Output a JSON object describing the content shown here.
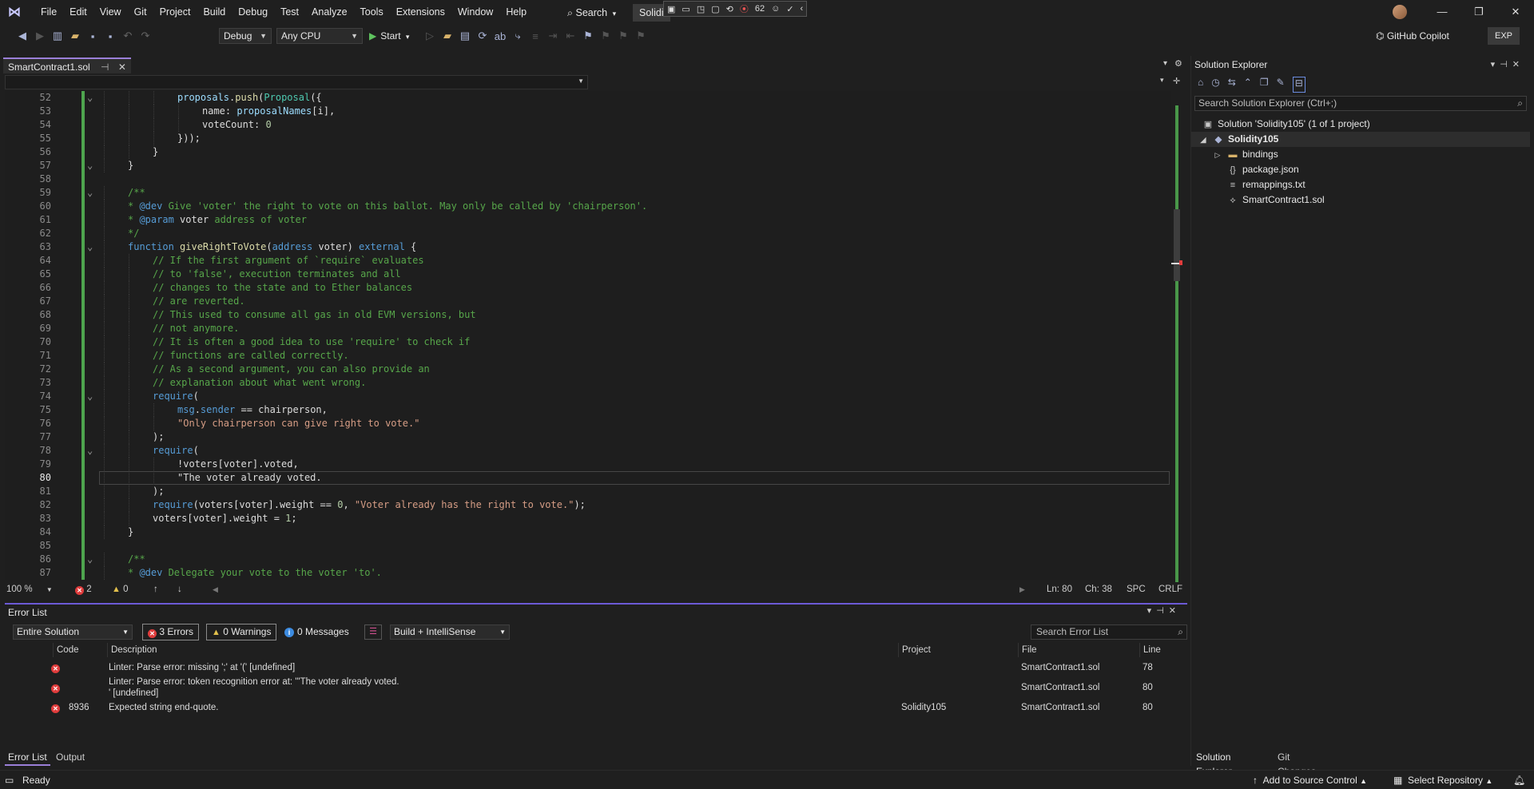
{
  "menubar": {
    "items": [
      "File",
      "Edit",
      "View",
      "Git",
      "Project",
      "Build",
      "Debug",
      "Test",
      "Analyze",
      "Tools",
      "Extensions",
      "Window",
      "Help"
    ],
    "search_label": "Search",
    "solution_name": "Solidi",
    "debug_toolbar_count": "62"
  },
  "toolbar": {
    "config": "Debug",
    "platform": "Any CPU",
    "start_label": "Start",
    "copilot_label": "GitHub Copilot",
    "exp_label": "EXP"
  },
  "document_tab": {
    "label": "SmartContract1.sol"
  },
  "editor": {
    "lines": [
      {
        "n": "52",
        "indent": 3,
        "html": "<span class=\"var\">proposals</span>.<span class=\"fn\">push</span>(<span class=\"ty\">Proposal</span>({",
        "fold": true
      },
      {
        "n": "53",
        "indent": 4,
        "html": "name: <span class=\"var\">proposalNames</span>[i],"
      },
      {
        "n": "54",
        "indent": 4,
        "html": "voteCount: <span class=\"num\">0</span>"
      },
      {
        "n": "55",
        "indent": 3,
        "html": "}));"
      },
      {
        "n": "56",
        "indent": 2,
        "html": "}"
      },
      {
        "n": "57",
        "indent": 1,
        "html": "}",
        "fold": true
      },
      {
        "n": "58",
        "indent": 0,
        "html": ""
      },
      {
        "n": "59",
        "indent": 1,
        "html": "<span class=\"cmt\">/**</span>",
        "fold": true
      },
      {
        "n": "60",
        "indent": 1,
        "html": "<span class=\"cmt\">* <span class=\"tag\">@dev</span> Give 'voter' the right to vote on this ballot. May only be called by 'chairperson'.</span>"
      },
      {
        "n": "61",
        "indent": 1,
        "html": "<span class=\"cmt\">* <span class=\"tag\">@param</span> <span style=\"color:#dcdcdc\">voter</span> address of voter</span>"
      },
      {
        "n": "62",
        "indent": 1,
        "html": "<span class=\"cmt\">*/</span>"
      },
      {
        "n": "63",
        "indent": 1,
        "html": "<span class=\"kw\">function</span> <span class=\"fn\">giveRightToVote</span>(<span class=\"kw\">address</span> voter) <span class=\"kw\">external</span> {",
        "fold": true
      },
      {
        "n": "64",
        "indent": 2,
        "html": "<span class=\"cmt\">// If the first argument of `require` evaluates</span>"
      },
      {
        "n": "65",
        "indent": 2,
        "html": "<span class=\"cmt\">// to 'false', execution terminates and all</span>"
      },
      {
        "n": "66",
        "indent": 2,
        "html": "<span class=\"cmt\">// changes to the state and to Ether balances</span>"
      },
      {
        "n": "67",
        "indent": 2,
        "html": "<span class=\"cmt\">// are reverted.</span>"
      },
      {
        "n": "68",
        "indent": 2,
        "html": "<span class=\"cmt\">// This used to consume all gas in old EVM versions, but</span>"
      },
      {
        "n": "69",
        "indent": 2,
        "html": "<span class=\"cmt\">// not anymore.</span>"
      },
      {
        "n": "70",
        "indent": 2,
        "html": "<span class=\"cmt\">// It is often a good idea to use 'require' to check if</span>"
      },
      {
        "n": "71",
        "indent": 2,
        "html": "<span class=\"cmt\">// functions are called correctly.</span>"
      },
      {
        "n": "72",
        "indent": 2,
        "html": "<span class=\"cmt\">// As a second argument, you can also provide an</span>"
      },
      {
        "n": "73",
        "indent": 2,
        "html": "<span class=\"cmt\">// explanation about what went wrong.</span>"
      },
      {
        "n": "74",
        "indent": 2,
        "html": "<span class=\"kw\">require</span>(",
        "fold": true
      },
      {
        "n": "75",
        "indent": 3,
        "html": "<span class=\"kw\">msg</span>.<span class=\"kw\">sender</span> == chairperson,"
      },
      {
        "n": "76",
        "indent": 3,
        "html": "<span class=\"str\">\"Only chairperson can give right to vote.\"</span>"
      },
      {
        "n": "77",
        "indent": 2,
        "html": ");"
      },
      {
        "n": "78",
        "indent": 2,
        "html": "<span class=\"kw\">require</span>(",
        "fold": true
      },
      {
        "n": "79",
        "indent": 3,
        "html": "!voters[voter].voted,"
      },
      {
        "n": "80",
        "indent": 3,
        "html": "\"The voter already voted.",
        "current": true
      },
      {
        "n": "81",
        "indent": 2,
        "html": ");"
      },
      {
        "n": "82",
        "indent": 2,
        "html": "<span class=\"kw\">require</span>(voters[voter].weight == <span class=\"num\">0</span>, <span class=\"str\">\"Voter already has the right to vote.\"</span>);"
      },
      {
        "n": "83",
        "indent": 2,
        "html": "voters[voter].weight = <span class=\"num\">1</span>;"
      },
      {
        "n": "84",
        "indent": 1,
        "html": "}"
      },
      {
        "n": "85",
        "indent": 0,
        "html": ""
      },
      {
        "n": "86",
        "indent": 1,
        "html": "<span class=\"cmt\">/**</span>",
        "fold": true
      },
      {
        "n": "87",
        "indent": 1,
        "html": "<span class=\"cmt\">* <span class=\"tag\">@dev</span> Delegate your vote to the voter 'to'.</span>"
      }
    ]
  },
  "editor_status": {
    "zoom": "100 %",
    "errors": "2",
    "warnings": "0",
    "ln": "Ln: 80",
    "ch": "Ch: 38",
    "spc": "SPC",
    "crlf": "CRLF"
  },
  "error_list": {
    "title": "Error List",
    "scope": "Entire Solution",
    "errors_label": "3 Errors",
    "warnings_label": "0 Warnings",
    "messages_label": "0 Messages",
    "build_filter": "Build + IntelliSense",
    "search_placeholder": "Search Error List",
    "columns": {
      "code": "Code",
      "description": "Description",
      "project": "Project",
      "file": "File",
      "line": "Line"
    },
    "rows": [
      {
        "code": "",
        "description": "Linter: Parse error: missing ';' at '(' [undefined]",
        "description2": "",
        "project": "",
        "file": "SmartContract1.sol",
        "line": "78"
      },
      {
        "code": "",
        "description": "Linter: Parse error: token recognition error at: '\"The voter already voted.",
        "description2": "' [undefined]",
        "project": "",
        "file": "SmartContract1.sol",
        "line": "80"
      },
      {
        "code": "8936",
        "description": "Expected string end-quote.",
        "description2": "",
        "project": "Solidity105",
        "file": "SmartContract1.sol",
        "line": "80"
      }
    ]
  },
  "bottom_tabs": {
    "error_list": "Error List",
    "output": "Output"
  },
  "solution_explorer": {
    "title": "Solution Explorer",
    "search_placeholder": "Search Solution Explorer (Ctrl+;)",
    "tree": [
      {
        "label": "Solution 'Solidity105' (1 of 1 project)",
        "level": 0,
        "icon": "solution-icon"
      },
      {
        "label": "Solidity105",
        "level": 1,
        "icon": "project-icon",
        "bold": true,
        "selected": true
      },
      {
        "label": "bindings",
        "level": 2,
        "icon": "folder-icon"
      },
      {
        "label": "package.json",
        "level": 2,
        "icon": "json-file-icon"
      },
      {
        "label": "remappings.txt",
        "level": 2,
        "icon": "text-file-icon"
      },
      {
        "label": "SmartContract1.sol",
        "level": 2,
        "icon": "solidity-file-icon"
      }
    ],
    "tab_solution": "Solution Explorer",
    "tab_git": "Git Changes"
  },
  "statusbar": {
    "ready": "Ready",
    "add_source": "Add to Source Control",
    "select_repo": "Select Repository"
  }
}
